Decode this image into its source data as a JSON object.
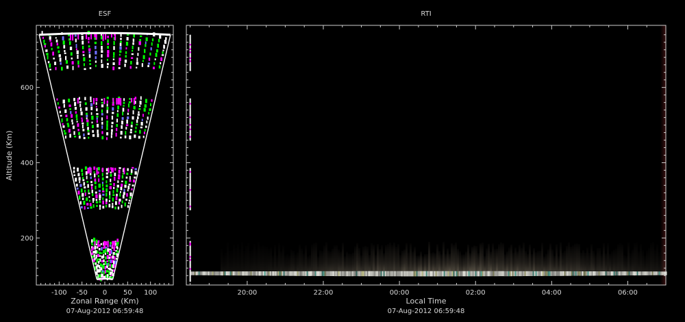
{
  "chart_data": [
    {
      "type": "heatmap",
      "title": "ESF",
      "xlabel": "Zonal Range (Km)",
      "ylabel": "Altitude (Km)",
      "timestamp": "07-Aug-2012 06:59:48",
      "xlim": [
        -150,
        150
      ],
      "ylim": [
        75,
        765
      ],
      "x_ticks": [
        -100,
        -50,
        0,
        50,
        100
      ],
      "x_tick_labels": [
        "-100",
        "-50",
        "0",
        "50",
        "100"
      ],
      "y_ticks": [
        200,
        400,
        600
      ],
      "y_tick_labels": [
        "200",
        "400",
        "600"
      ],
      "beam_half_angle_deg": 11,
      "range_window_km": [
        90,
        740
      ],
      "echo_layers_km": [
        {
          "bottom": 85,
          "top": 190
        },
        {
          "bottom": 275,
          "top": 385
        },
        {
          "bottom": 460,
          "top": 570
        },
        {
          "bottom": 645,
          "top": 740
        }
      ],
      "echo_colors": [
        "#ffffff",
        "#00ff00",
        "#ff00ff",
        "#7070ff"
      ]
    },
    {
      "type": "heatmap",
      "title": "RTI",
      "xlabel": "Local Time",
      "ylabel": "",
      "timestamp": "07-Aug-2012 06:59:48",
      "x_range_hours": [
        18.4,
        31.0
      ],
      "ylim": [
        75,
        765
      ],
      "x_ticks_hours": [
        20,
        22,
        24,
        26,
        28,
        30
      ],
      "x_tick_labels": [
        "20:00",
        "22:00",
        "00:00",
        "02:00",
        "04:00",
        "06:00"
      ],
      "y_ticks": [
        200,
        400,
        600
      ],
      "layers": [
        {
          "name": "bright layer",
          "bottom_km": 98,
          "top_km": 112,
          "color": "#e8e8e0"
        },
        {
          "name": "diffuse layer",
          "bottom_km": 112,
          "top_km": 190,
          "color": "#9a8c78"
        }
      ],
      "bright_layer_hours": [
        18.5,
        31.0
      ],
      "diffuse_layer_hours": [
        19.3,
        31.0
      ],
      "start_marker_hours": 18.5,
      "start_marker_altitudes_km": [
        85,
        190,
        275,
        385,
        460,
        570,
        645,
        740
      ]
    }
  ]
}
